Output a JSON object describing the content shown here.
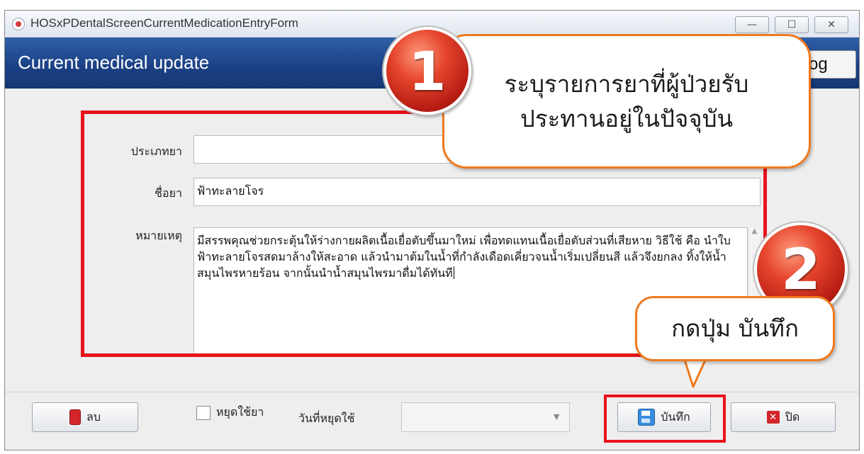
{
  "window": {
    "title": "HOSxPDentalScreenCurrentMedicationEntryForm",
    "minimize_glyph": "—",
    "maximize_glyph": "☐",
    "close_glyph": "✕"
  },
  "header": {
    "title": "Current medical update",
    "log_button_label": "og"
  },
  "form": {
    "drug_type_label": "ประเภทยา",
    "drug_type_value": "",
    "drug_name_label": "ชื่อยา",
    "drug_name_value": "ฟ้าทะลายโจร",
    "notes_label": "หมายเหตุ",
    "notes_value": "มีสรรพคุณช่วยกระตุ้นให้ร่างกายผลิตเนื้อเยื่อตับขึ้นมาใหม่ เพื่อทดแทนเนื้อเยื่อตับส่วนที่เสียหาย วิธีใช้ คือ นำใบฟ้าทะลายโจรสดมาล้างให้สะอาด แล้วนำมาต้มในน้ำที่กำลังเดือดเคี่ยวจนน้ำเริ่มเปลี่ยนสี แล้วจึงยกลง ทิ้งให้น้ำสมุนไพรหายร้อน จากนั้นนำน้ำสมุนไพรมาดื่มได้ทันที",
    "scroll_up_glyph": "▲"
  },
  "bottom": {
    "delete_label": "ลบ",
    "stop_checkbox_label": "หยุดใช้ยา",
    "stop_date_label": "วันที่หยุดใช้",
    "stop_date_value": "",
    "dropdown_glyph": "▼",
    "save_label": "บันทึก",
    "close_label": "ปิด",
    "close_icon_glyph": "✕"
  },
  "callouts": {
    "step1_number": "1",
    "step1_line1": "ระบุรายการยาที่ผู้ป่วยรับ",
    "step1_line2": "ประทานอยู่ในปัจจุบัน",
    "step2_number": "2",
    "step2_text": "กดปุ่ม บันทึก"
  },
  "colors": {
    "header_blue": "#1a3f83",
    "highlight_red": "#e8141b",
    "callout_orange": "#ef7a1f",
    "badge_red": "#d43322"
  }
}
